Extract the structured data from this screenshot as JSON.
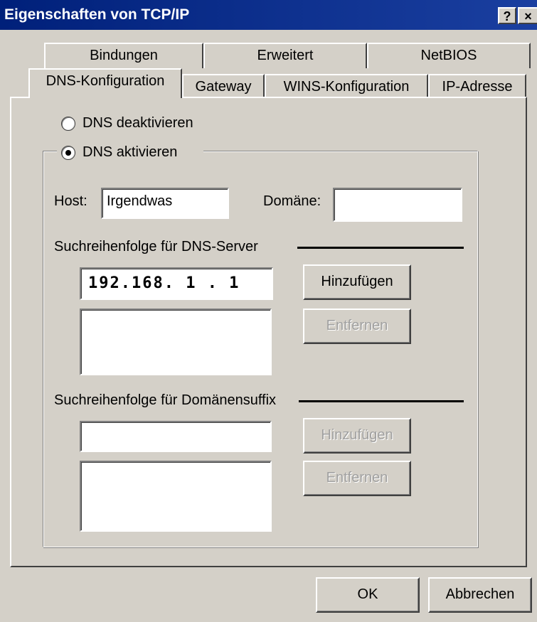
{
  "window": {
    "title": "Eigenschaften von TCP/IP",
    "help_label": "?",
    "close_label": "×"
  },
  "tabs_back": [
    {
      "label": "Bindungen"
    },
    {
      "label": "Erweitert"
    },
    {
      "label": "NetBIOS"
    }
  ],
  "tabs_front": [
    {
      "label": "DNS-Konfiguration",
      "active": true
    },
    {
      "label": "Gateway"
    },
    {
      "label": "WINS-Konfiguration"
    },
    {
      "label": "IP-Adresse"
    }
  ],
  "dns": {
    "disable_label": "DNS deaktivieren",
    "enable_label": "DNS aktivieren",
    "enabled": true,
    "host_label": "Host:",
    "host_value": "Irgendwas",
    "domain_label": "Domäne:",
    "domain_value": "",
    "server_order_label": "Suchreihenfolge für DNS-Server",
    "server_ip_value": "192.168.  1  .  1",
    "server_list": [],
    "add_label": "Hinzufügen",
    "remove_label": "Entfernen",
    "suffix_order_label": "Suchreihenfolge für Domänensuffix",
    "suffix_value": "",
    "suffix_list": [],
    "suffix_add_label": "Hinzufügen",
    "suffix_remove_label": "Entfernen"
  },
  "footer": {
    "ok_label": "OK",
    "cancel_label": "Abbrechen"
  },
  "colors": {
    "titlebar": "#0a2a8a",
    "face": "#d4d0c8",
    "disabled_text": "#a0a0a0"
  }
}
